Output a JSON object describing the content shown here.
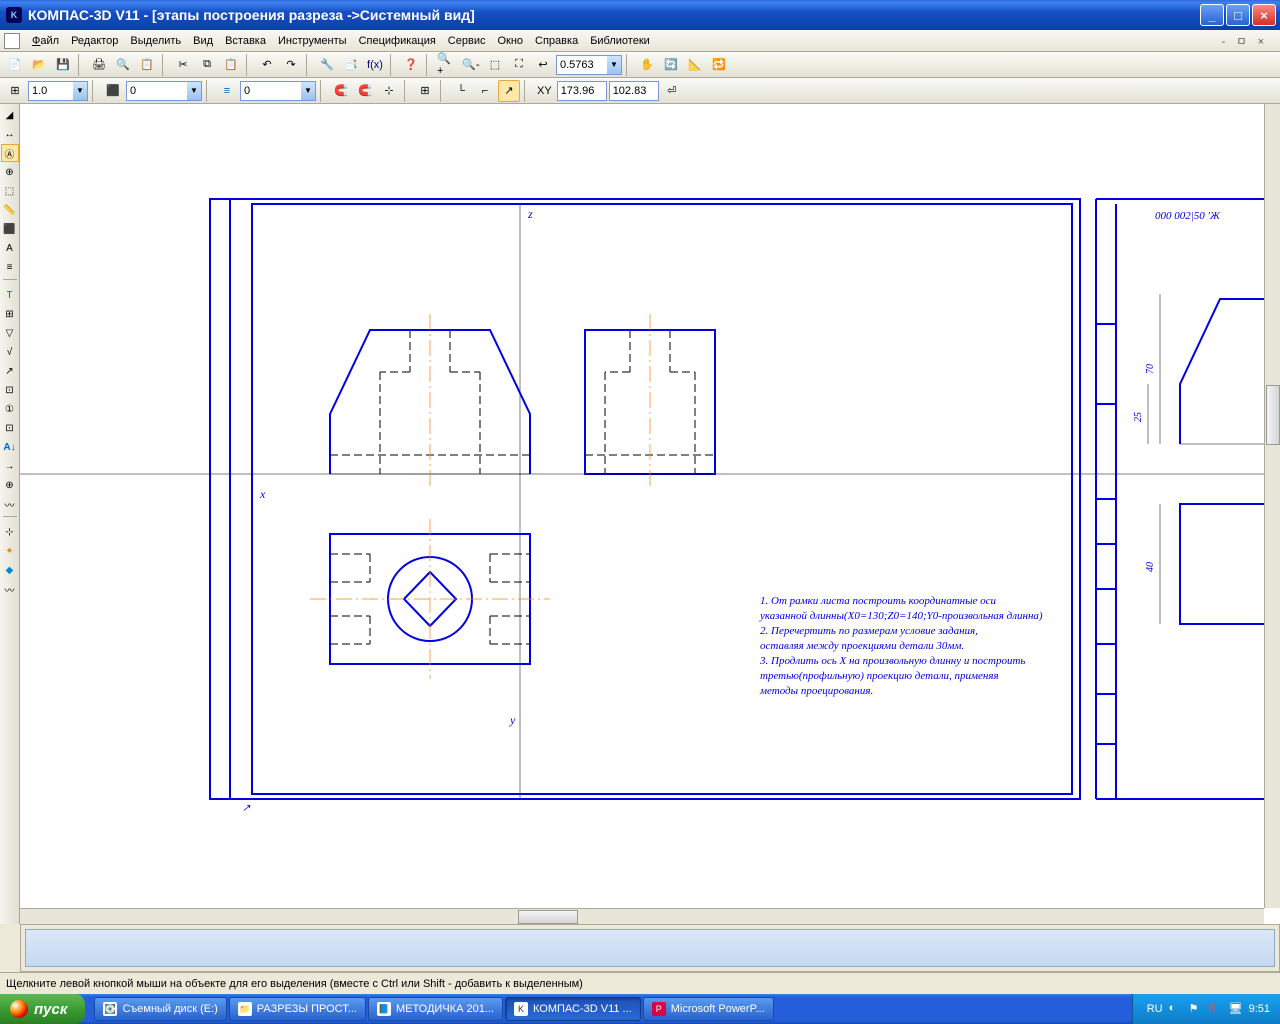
{
  "title": "КОМПАС-3D V11 - [этапы построения разреза ->Системный вид]",
  "menu": {
    "file": "Файл",
    "edit": "Редактор",
    "select": "Выделить",
    "view": "Вид",
    "insert": "Вставка",
    "tools": "Инструменты",
    "spec": "Спецификация",
    "service": "Сервис",
    "window": "Окно",
    "help": "Справка",
    "lib": "Библиотеки",
    "mdi": "- ㅁ ×"
  },
  "toolbar2": {
    "zoom_value": "0.5763"
  },
  "toolbar3": {
    "step": "1.0",
    "layer": "0",
    "style": "0",
    "coord_x": "173.96",
    "coord_y": "102.83"
  },
  "drawing": {
    "axis_x": "x",
    "axis_y": "y",
    "axis_z": "z",
    "dim_70": "70",
    "dim_40": "40",
    "dim_25": "25",
    "side_text": "000 002|50 'Ж",
    "notes": [
      "1. От рамки листа построить координатные оси",
      "указанной длинны(X0=130;Z0=140;Y0-произвольная длинна)",
      "2. Перечертить по размерам условие задания,",
      "оставляя между проекциями детали 30мм.",
      "3. Продлить ось X на произвольную длинну и построить",
      "третью(профильную) проекцию детали, применяя",
      "методы проецирования."
    ]
  },
  "status": "Щелкните левой кнопкой мыши на объекте для его выделения (вместе с Ctrl или Shift - добавить к выделенным)",
  "taskbar": {
    "start": "пуск",
    "items": [
      "Съемный диск (E:)",
      "РАЗРЕЗЫ ПРОСТ...",
      "МЕТОДИЧКА 201...",
      "КОМПАС-3D V11 ...",
      "Microsoft PowerP..."
    ],
    "lang": "RU",
    "clock": "9:51"
  }
}
